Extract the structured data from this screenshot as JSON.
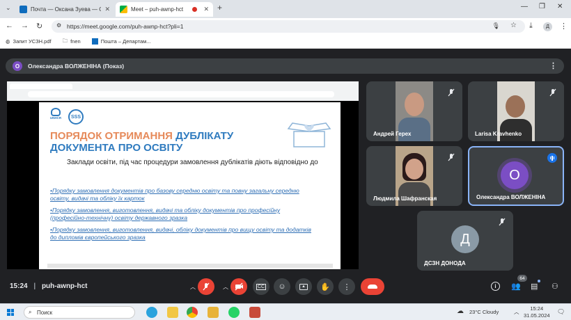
{
  "browser": {
    "tabs": [
      {
        "label": "Почта — Оксана Зуева — Outl",
        "icon": "outlook-icon",
        "active": false
      },
      {
        "label": "Meet – puh-awnp-hct",
        "icon": "meet-icon",
        "active": true
      }
    ],
    "url": "https://meet.google.com/puh-awnp-hct?pli=1",
    "bookmarks": [
      "Запит УСЗН.pdf",
      "fnen",
      "Пошта – Департам..."
    ]
  },
  "meet": {
    "presenter_label": "Олександра ВОЛЖЕНІНА (Показ)",
    "presenter_initial": "О",
    "time": "15:24",
    "code": "puh-awnp-hct",
    "participant_count": "64",
    "participants": [
      {
        "name": "Андрей Герех",
        "type": "video"
      },
      {
        "name": "Larisa Kravhenko",
        "type": "video"
      },
      {
        "name": "Людмила Шафранская",
        "type": "video"
      },
      {
        "name": "Олександра ВОЛЖЕНІНА",
        "type": "avatar",
        "initial": "О",
        "color": "#7b4ec4"
      },
      {
        "name": "ДСЗН ДОНОДА",
        "type": "avatar",
        "initial": "Д",
        "color": "#8a9aa6"
      }
    ]
  },
  "slide": {
    "logo_text": "UNHCR",
    "title_a": "ПОРЯДОК ОТРИМАННЯ",
    "title_b": "ДУБЛІКАТУ",
    "title_c": "ДОКУМЕНТА ПРО ОСВІТУ",
    "subtitle": "Заклади освіти, під час процедури замовлення дублікатів діють відповідно до",
    "links": [
      "•Порядку замовлення документів про базову середню освіту та повну загальну середню освіту, видачі та обліку їх карток",
      "•Порядку замовлення, виготовлення, видачі та обліку документів про професійну (професійно-технічну) освіту державного зразка",
      "•Порядку замовлення, виготовлення, видачі, обліку документів про вищу освіту та додатків до дипломів європейського зразка"
    ]
  },
  "taskbar": {
    "search_placeholder": "Поиск",
    "weather": "23°C  Cloudy",
    "time": "15:24",
    "date": "31.05.2024"
  },
  "colors": {
    "meet_bg": "#202124",
    "tile_bg": "#3c4043",
    "red": "#ea4335",
    "active_outline": "#8ab4f8"
  }
}
